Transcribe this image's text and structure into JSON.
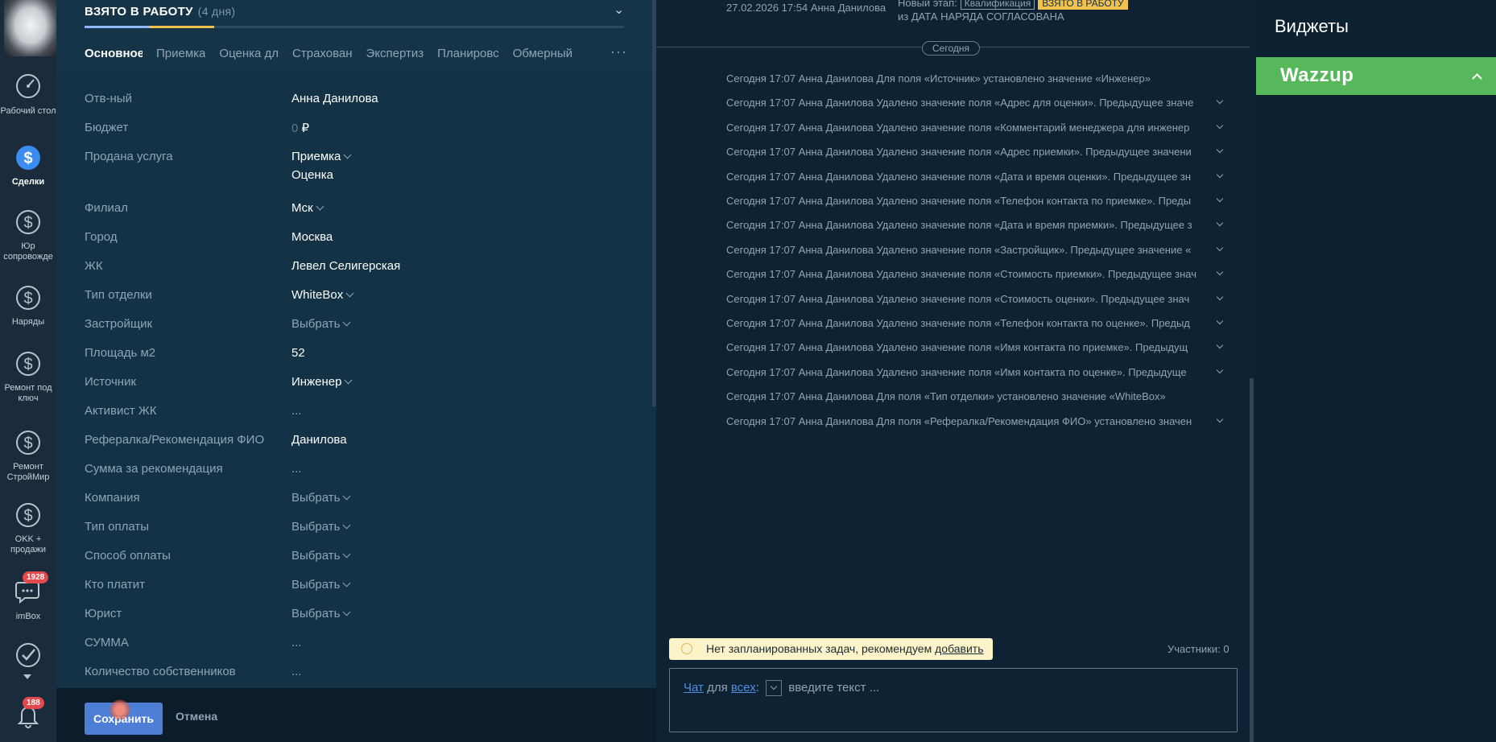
{
  "nav": {
    "items": [
      {
        "label": "Рабочий стол",
        "icon": "dashboard-icon"
      },
      {
        "label": "Сделки",
        "icon": "deals-icon",
        "active": true
      },
      {
        "label": "Юр сопровожде",
        "icon": "dollar-icon"
      },
      {
        "label": "Наряды",
        "icon": "dollar-icon"
      },
      {
        "label": "Ремонт под ключ",
        "icon": "dollar-icon"
      },
      {
        "label": "Ремонт СтройМир",
        "icon": "dollar-icon"
      },
      {
        "label": "OKK + продажи",
        "icon": "dollar-icon"
      },
      {
        "label": "imBox",
        "icon": "chat-icon",
        "badge": "1928"
      },
      {
        "label": "",
        "icon": "checkmark-icon"
      },
      {
        "label": "",
        "icon": "bell-icon",
        "badge": "188"
      }
    ]
  },
  "lead": {
    "status": "ВЗЯТО В РАБОТУ",
    "status_days": "(4 дня)",
    "progress": 0.24,
    "tabs": [
      "Основное",
      "Приемка",
      "Оценка дл",
      "Страхован",
      "Экспертиз",
      "Планировс",
      "Обмерный"
    ],
    "tabs_more": "···",
    "fields": [
      {
        "label": "Отв-ный",
        "value": "Анна Данилова"
      },
      {
        "label": "Бюджет",
        "value_zero": "0",
        "value": "₽"
      },
      {
        "label": "Продана услуга",
        "value": "Приемка",
        "value2": "Оценка",
        "dropdown": true
      },
      {
        "label": "Филиал",
        "value": "Мск",
        "dropdown": true
      },
      {
        "label": "Город",
        "value": "Москва"
      },
      {
        "label": "ЖК",
        "value": "Левел Селигерская"
      },
      {
        "label": "Тип отделки",
        "value": "WhiteBox",
        "dropdown": true
      },
      {
        "label": "Застройщик",
        "value": "Выбрать",
        "dropdown": true,
        "muted": true
      },
      {
        "label": "Площадь м2",
        "value": "52"
      },
      {
        "label": "Источник",
        "value": "Инженер",
        "dropdown": true
      },
      {
        "label": "Активист ЖК",
        "value": "...",
        "muted": true
      },
      {
        "label": "Рефералка/Рекомендация ФИО",
        "value": "Данилова"
      },
      {
        "label": "Сумма за рекомендация",
        "value": "...",
        "muted": true
      },
      {
        "label": "Компания",
        "value": "Выбрать",
        "dropdown": true,
        "muted": true
      },
      {
        "label": "Тип оплаты",
        "value": "Выбрать",
        "dropdown": true,
        "muted": true
      },
      {
        "label": "Способ оплаты",
        "value": "Выбрать",
        "dropdown": true,
        "muted": true
      },
      {
        "label": "Кто платит",
        "value": "Выбрать",
        "dropdown": true,
        "muted": true
      },
      {
        "label": "Юрист",
        "value": "Выбрать",
        "dropdown": true,
        "muted": true
      },
      {
        "label": "СУММА",
        "value": "...",
        "muted": true
      },
      {
        "label": "Количество собственников",
        "value": "...",
        "muted": true
      }
    ],
    "save_label": "Сохранить",
    "cancel_label": "Отмена"
  },
  "feed": {
    "top_date": "27.02.2026 17:54 Анна Данилова",
    "top_stage_prefix": "Новый этап:",
    "top_stage_from": "Квалификация",
    "top_stage_to": "ВЗЯТО В РАБОТУ",
    "top_line2": "из ДАТА НАРЯДА СОГЛАСОВАНА",
    "today": "Сегодня",
    "rows": [
      {
        "text": "Сегодня 17:07 Анна Данилова Для поля «Источник» установлено значение «Инженер»",
        "expand": false
      },
      {
        "text": "Сегодня 17:07 Анна Данилова Удалено значение поля «Адрес для оценки». Предыдущее значе",
        "expand": true
      },
      {
        "text": "Сегодня 17:07 Анна Данилова Удалено значение поля «Комментарий менеджера для инженер",
        "expand": true
      },
      {
        "text": "Сегодня 17:07 Анна Данилова Удалено значение поля «Адрес приемки». Предыдущее значени",
        "expand": true
      },
      {
        "text": "Сегодня 17:07 Анна Данилова Удалено значение поля «Дата и время оценки». Предыдущее зн",
        "expand": true
      },
      {
        "text": "Сегодня 17:07 Анна Данилова Удалено значение поля «Телефон контакта по приемке». Преды",
        "expand": true
      },
      {
        "text": "Сегодня 17:07 Анна Данилова Удалено значение поля «Дата и время приемки». Предыдущее з",
        "expand": true
      },
      {
        "text": "Сегодня 17:07 Анна Данилова Удалено значение поля «Застройщик». Предыдущее значение «",
        "expand": true
      },
      {
        "text": "Сегодня 17:07 Анна Данилова Удалено значение поля «Стоимость приемки». Предыдущее знач",
        "expand": true
      },
      {
        "text": "Сегодня 17:07 Анна Данилова Удалено значение поля «Стоимость оценки». Предыдущее знач",
        "expand": true
      },
      {
        "text": "Сегодня 17:07 Анна Данилова Удалено значение поля «Телефон контакта по оценке». Предыд",
        "expand": true
      },
      {
        "text": "Сегодня 17:07 Анна Данилова Удалено значение поля «Имя контакта по приемке». Предыдущ",
        "expand": true
      },
      {
        "text": "Сегодня 17:07 Анна Данилова Удалено значение поля «Имя контакта по оценке». Предыдуще",
        "expand": true
      },
      {
        "text": "Сегодня 17:07 Анна Данилова Для поля «Тип отделки» установлено значение «WhiteBox»",
        "expand": false
      },
      {
        "text": "Сегодня 17:07 Анна Данилова Для поля «Рефералка/Рекомендация ФИО» установлено значен",
        "expand": true
      }
    ],
    "tasks_notice": "Нет запланированных задач, рекомендуем",
    "tasks_add": "добавить",
    "participants": "Участники: 0",
    "chat_mode": "Чат",
    "chat_for": "для",
    "chat_target": "всех",
    "chat_placeholder": "введите текст ..."
  },
  "widgets": {
    "title": "Виджеты",
    "wazzup": "Wazzup"
  }
}
